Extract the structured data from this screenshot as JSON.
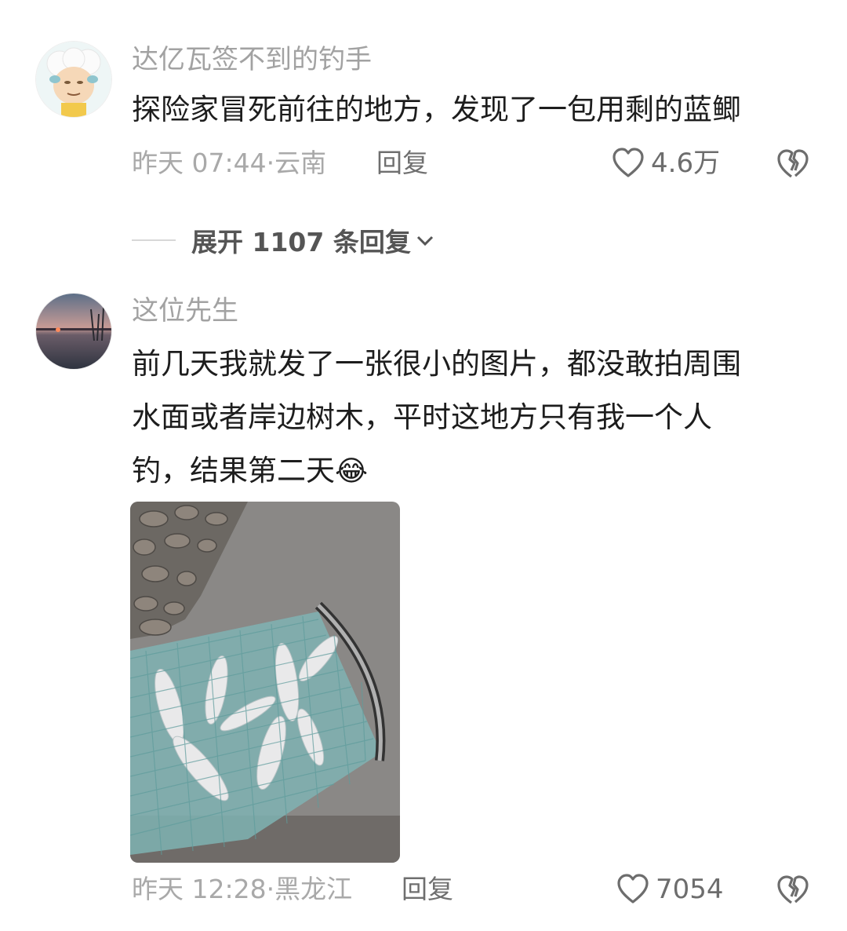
{
  "comments": [
    {
      "author": "达亿瓦签不到的钓手",
      "text_lines": [
        "探险家冒死前往的地方，发现了一包用剩的蓝鲫"
      ],
      "time": "昨天 07:44",
      "location": "云南",
      "reply_label": "回复",
      "likes": "4.6万",
      "expand_label": "展开 1107 条回复"
    },
    {
      "author": "这位先生",
      "text_lines": [
        "前几天我就发了一张很小的图片，都没敢拍周围",
        "水面或者岸边树木，平时这地方只有我一个人",
        "钓，结果第二天"
      ],
      "emoji": "😂",
      "time": "昨天 12:28",
      "location": "黑龙江",
      "reply_label": "回复",
      "likes": "7054"
    }
  ],
  "icons": {
    "heart": "heart-icon",
    "broken_heart": "broken-heart-icon",
    "chevron": "chevron-down-icon"
  },
  "colors": {
    "text": "#1d1d1d",
    "meta": "#a9a9a9",
    "icon": "#6d6d6d"
  }
}
